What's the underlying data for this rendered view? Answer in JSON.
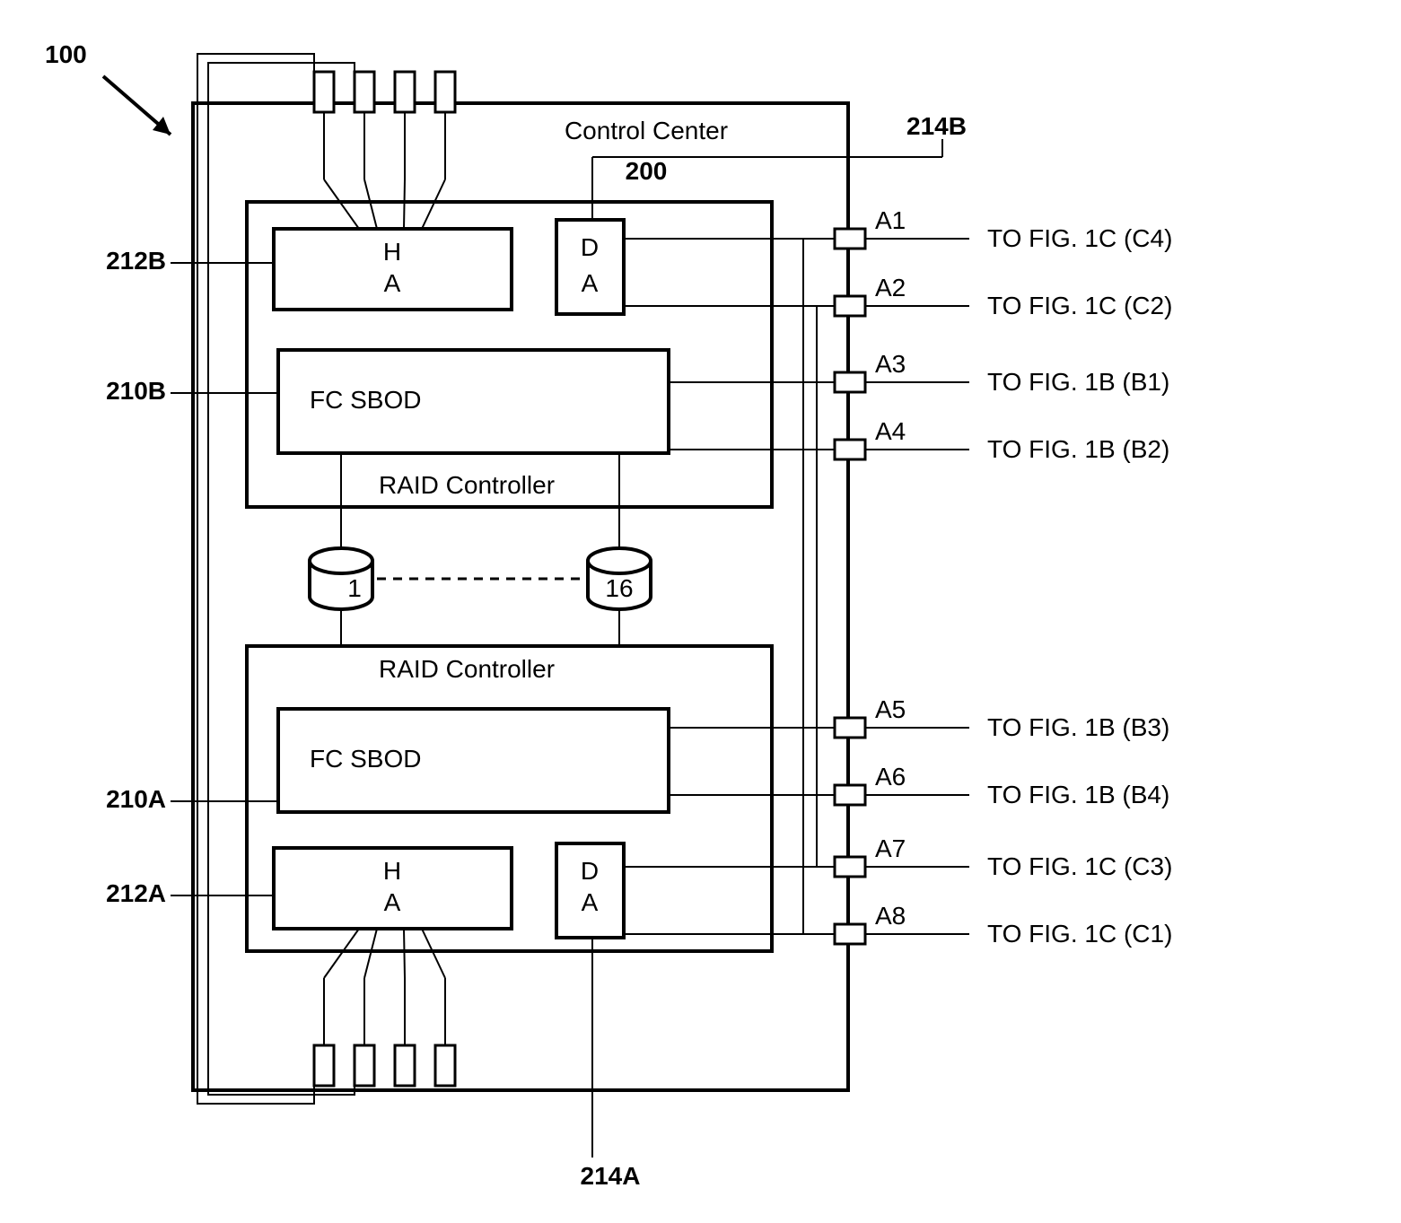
{
  "figure_ref": "100",
  "control_center": {
    "label": "Control Center",
    "ref": "200"
  },
  "top": {
    "raid_label": "RAID Controller",
    "ha": {
      "line1": "H",
      "line2": "A",
      "ref": "212B"
    },
    "da": {
      "line1": "D",
      "line2": "A",
      "ref": "214B"
    },
    "sbod": {
      "label": "FC SBOD",
      "ref": "210B"
    }
  },
  "bottom": {
    "raid_label": "RAID Controller",
    "ha": {
      "line1": "H",
      "line2": "A",
      "ref": "212A"
    },
    "da": {
      "line1": "D",
      "line2": "A",
      "ref": "214A"
    },
    "sbod": {
      "label": "FC SBOD",
      "ref": "210A"
    }
  },
  "disks": {
    "first": "1",
    "last": "16"
  },
  "ports": {
    "a1": {
      "tag": "A1",
      "dest": "TO FIG. 1C (C4)"
    },
    "a2": {
      "tag": "A2",
      "dest": "TO FIG. 1C (C2)"
    },
    "a3": {
      "tag": "A3",
      "dest": "TO FIG. 1B (B1)"
    },
    "a4": {
      "tag": "A4",
      "dest": "TO FIG. 1B (B2)"
    },
    "a5": {
      "tag": "A5",
      "dest": "TO FIG. 1B (B3)"
    },
    "a6": {
      "tag": "A6",
      "dest": "TO FIG. 1B (B4)"
    },
    "a7": {
      "tag": "A7",
      "dest": "TO FIG. 1C (C3)"
    },
    "a8": {
      "tag": "A8",
      "dest": "TO FIG. 1C (C1)"
    }
  }
}
